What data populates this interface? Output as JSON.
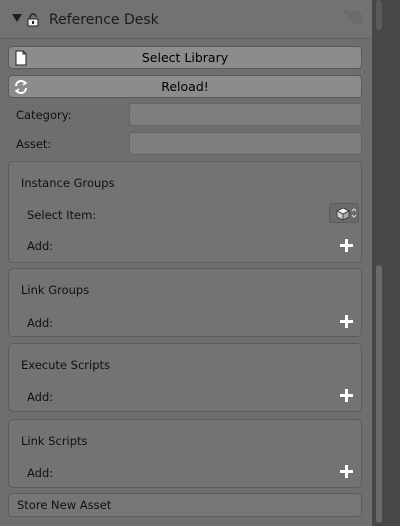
{
  "panel": {
    "title": "Reference Desk"
  },
  "buttons": {
    "select_library": "Select Library",
    "reload": "Reload!"
  },
  "fields": {
    "category_label": "Category:",
    "category_value": "",
    "asset_label": "Asset:",
    "asset_value": ""
  },
  "sections": [
    {
      "title": "Instance Groups",
      "select_item_label": "Select Item:",
      "add_label": "Add:"
    },
    {
      "title": "Link Groups",
      "add_label": "Add:"
    },
    {
      "title": "Execute Scripts",
      "add_label": "Add:"
    },
    {
      "title": "Link Scripts",
      "add_label": "Add:"
    }
  ],
  "store_new_asset": "Store New Asset",
  "icons": {
    "collapse": "triangle-down-icon",
    "lock": "lock-icon",
    "file": "file-icon",
    "reload": "reload-icon",
    "add": "plus-icon",
    "object": "object-selector-icon",
    "drag": "drag-handle-icon"
  }
}
